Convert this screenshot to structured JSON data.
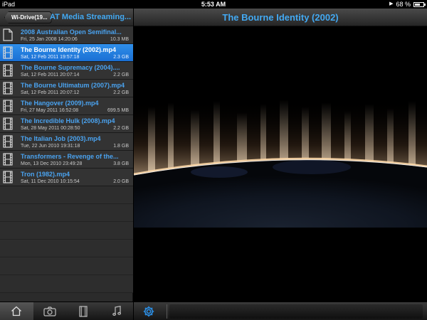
{
  "status_bar": {
    "device": "iPad",
    "time": "5:53 AM",
    "battery": "68 %",
    "battery_level": 0.68
  },
  "sidebar": {
    "back_label": "Wi-Drive(19...",
    "title": "AT Media Streaming...",
    "files": [
      {
        "name": "2008 Australian Open Semifinal...",
        "date": "Fri, 25 Jan 2008 14:20:06",
        "size": "10.3 MB",
        "icon": "document-icon",
        "selected": false
      },
      {
        "name": "The Bourne Identity (2002).mp4",
        "date": "Sat, 12 Feb 2011 19:57:18",
        "size": "2.3 GB",
        "icon": "film-icon",
        "selected": true
      },
      {
        "name": "The Bourne Supremacy (2004)....",
        "date": "Sat, 12 Feb 2011 20:07:14",
        "size": "2.2 GB",
        "icon": "film-icon",
        "selected": false
      },
      {
        "name": "The Bourne Ultimatum (2007).mp4",
        "date": "Sat, 12 Feb 2011 20:07:12",
        "size": "2.2 GB",
        "icon": "film-icon",
        "selected": false
      },
      {
        "name": "The Hangover (2009).mp4",
        "date": "Fri, 27 May 2011 16:52:08",
        "size": "699.5 MB",
        "icon": "film-icon",
        "selected": false
      },
      {
        "name": "The Incredible Hulk (2008).mp4",
        "date": "Sat, 28 May 2011 00:28:50",
        "size": "2.2 GB",
        "icon": "film-icon",
        "selected": false
      },
      {
        "name": "The Italian Job (2003).mp4",
        "date": "Tue, 22 Jun 2010 19:31:18",
        "size": "1.8 GB",
        "icon": "film-icon",
        "selected": false
      },
      {
        "name": "Transformers - Revenge of the...",
        "date": "Mon, 13 Dec 2010 23:49:28",
        "size": "3.8 GB",
        "icon": "film-icon",
        "selected": false
      },
      {
        "name": "Tron (1982).mp4",
        "date": "Sat, 11 Dec 2010 10:15:54",
        "size": "2.0 GB",
        "icon": "film-icon",
        "selected": false
      }
    ],
    "tabs": [
      {
        "icon": "home-icon",
        "active": true
      },
      {
        "icon": "camera-icon",
        "active": false
      },
      {
        "icon": "film-icon",
        "active": false
      },
      {
        "icon": "music-icon",
        "active": false
      }
    ]
  },
  "player": {
    "title": "The Bourne Identity (2002)"
  },
  "colors": {
    "accent_blue": "#43a9f2",
    "selection_blue": "#1a6fd4",
    "panel_dark": "#2b2b2b"
  }
}
